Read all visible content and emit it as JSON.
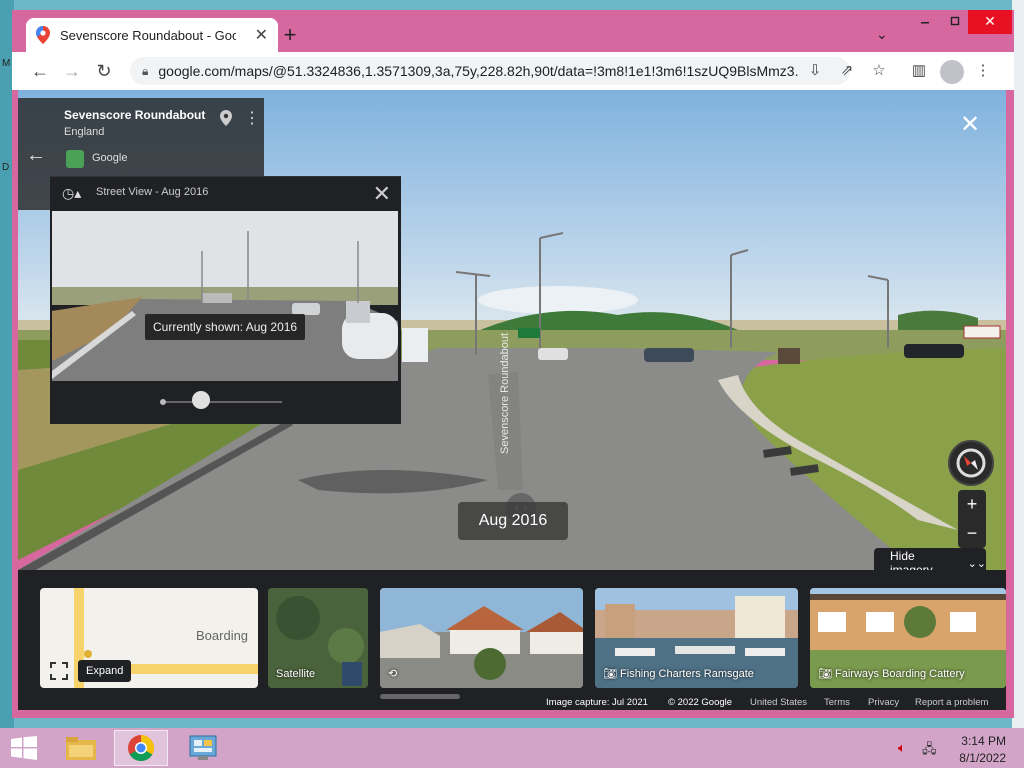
{
  "browser": {
    "tab_title": "Sevenscore Roundabout - Googl",
    "new_tab": "+",
    "url": "google.com/maps/@51.3324836,1.3571309,3a,75y,228.82h,90t/data=!3m8!1e1!3m6!1sz­UQ9BlsMmz3..."
  },
  "place": {
    "name": "Sevenscore Roundabout",
    "region": "England",
    "provider": "Google"
  },
  "time_machine": {
    "title": "Street View - Aug 2016",
    "currently_shown": "Currently shown: Aug 2016"
  },
  "scene": {
    "road_text": "Sevenscore Roundabout",
    "date_pill": "Aug 2016"
  },
  "controls": {
    "zoom_in": "+",
    "zoom_out": "−",
    "hide_imagery": "Hide imagery"
  },
  "filmstrip": {
    "map_word": "Boarding",
    "expand_tip": "Expand",
    "cards": [
      {
        "label": "Satellite"
      },
      {
        "label": ""
      },
      {
        "label": "Fishing Charters Ramsgate"
      },
      {
        "label": "Fairways Boarding Cattery"
      }
    ]
  },
  "footer": {
    "image_capture": "Image capture: Jul 2021",
    "copyright": "© 2022 Google",
    "country": "United States",
    "terms": "Terms",
    "privacy": "Privacy",
    "report": "Report a problem"
  },
  "taskbar": {
    "time": "3:14 PM",
    "date": "8/1/2022"
  },
  "desktop_edge": [
    "M",
    "D"
  ],
  "colors": {
    "titlebar": "#d7689f",
    "taskbar": "#d2a5c8",
    "panel": "#202124"
  }
}
